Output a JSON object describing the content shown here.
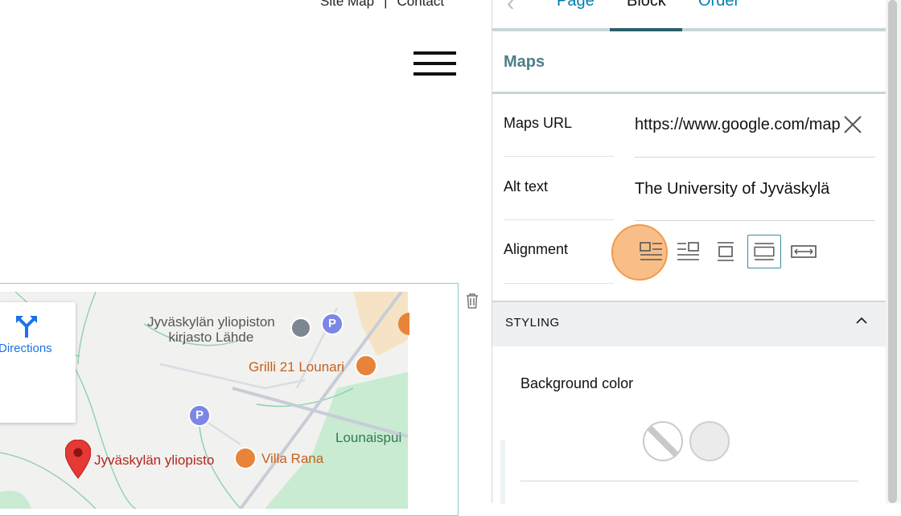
{
  "website": {
    "top_nav": {
      "site_map": "Site Map",
      "separator": "|",
      "contact": "Contact"
    },
    "map": {
      "directions_label": "Directions",
      "places": {
        "library_line1": "Jyväskylän yliopiston",
        "library_line2": "kirjasto Lähde",
        "grilli": "Grilli 21 Lounari",
        "university": "Jyväskylän yliopisto",
        "villa_rana": "Villa Rana",
        "lounaispuisto": "Lounaispui"
      },
      "parking_symbol": "P"
    }
  },
  "sidebar": {
    "tabs": {
      "page": "Page",
      "block": "Block",
      "order": "Order"
    },
    "active_tab": "Block",
    "panel_title": "Maps",
    "fields": {
      "maps_url": {
        "label": "Maps URL",
        "value": "https://www.google.com/maps"
      },
      "alt_text": {
        "label": "Alt text",
        "value": "The University of Jyväskylä"
      },
      "alignment": {
        "label": "Alignment",
        "options": [
          "left",
          "right",
          "center",
          "full",
          "wide"
        ],
        "selected": "full"
      }
    },
    "styling": {
      "header": "STYLING",
      "background_color_label": "Background color",
      "swatches": [
        "none",
        "#ebebeb"
      ]
    }
  },
  "colors": {
    "accent": "#007eb1",
    "tab_active_bar": "#2b5f6b",
    "title": "#4e7d89",
    "highlight": "#f7a55a"
  }
}
